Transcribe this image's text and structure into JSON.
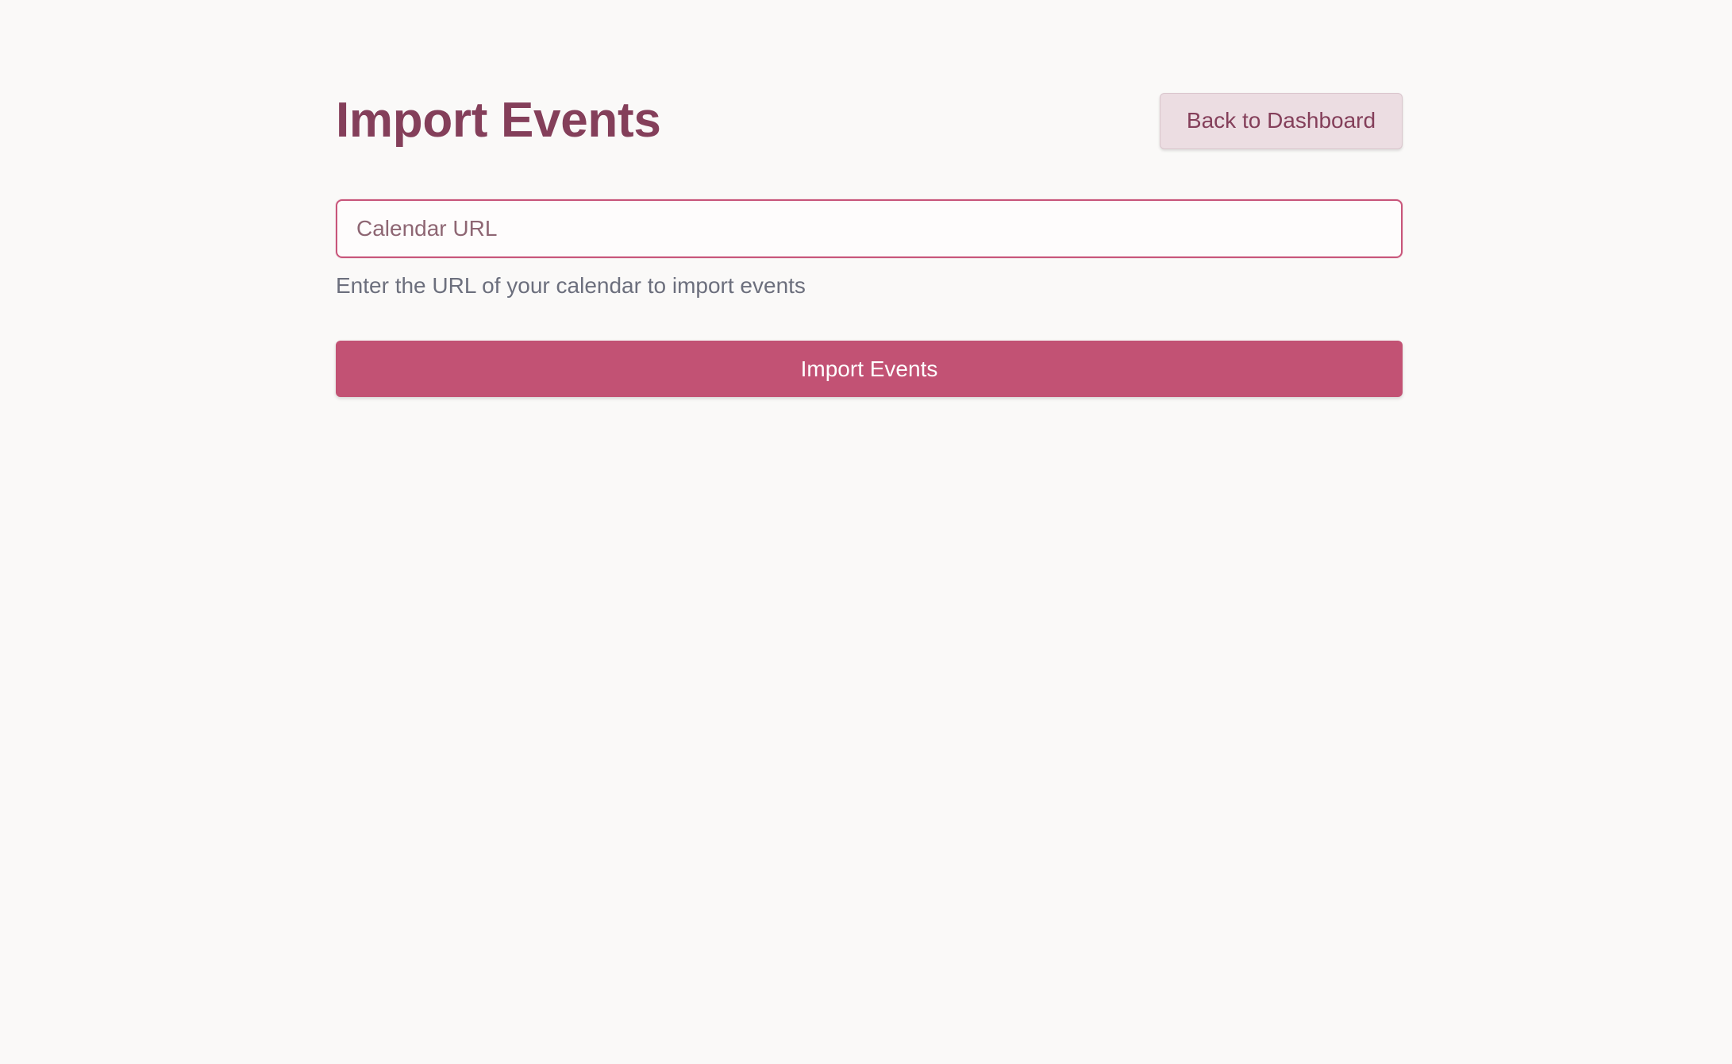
{
  "header": {
    "title": "Import Events",
    "back_label": "Back to Dashboard"
  },
  "form": {
    "url_value": "",
    "url_placeholder": "Calendar URL",
    "helper_text": "Enter the URL of your calendar to import events",
    "submit_label": "Import Events"
  },
  "colors": {
    "accent": "#c25274",
    "title": "#843f5a",
    "secondary_button_bg": "#ecdde2",
    "background": "#faf9f8",
    "helper_text": "#6c6f7d"
  }
}
